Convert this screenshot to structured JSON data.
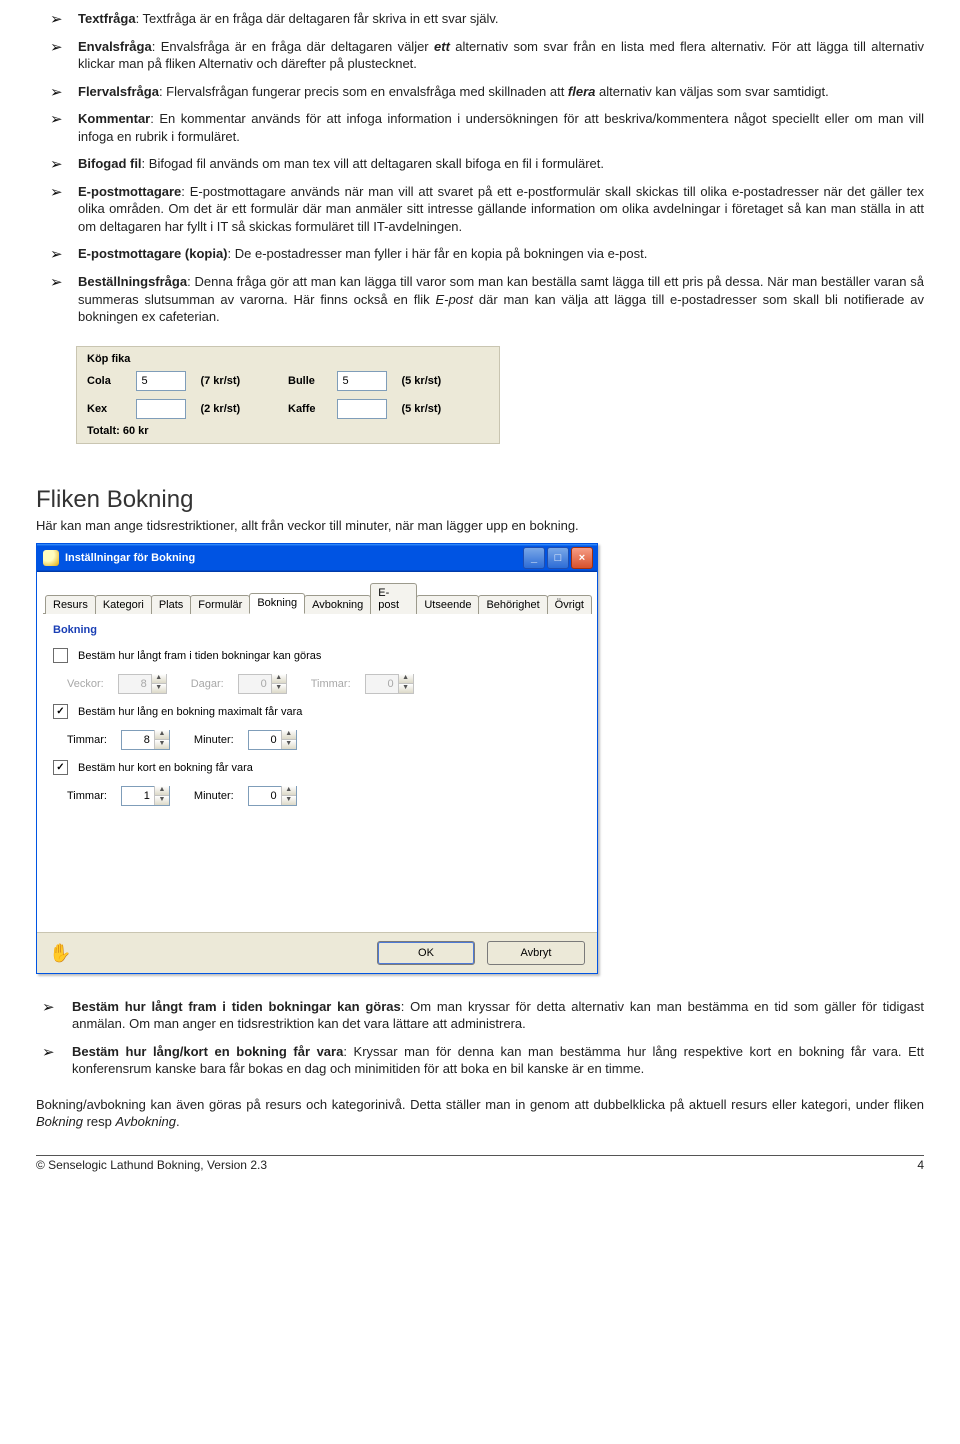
{
  "bul": [
    {
      "title": "Textfråga",
      "body": ": Textfråga är en fråga där deltagaren får skriva in ett svar själv."
    },
    {
      "title": "Envalsfråga",
      "body": ": Envalsfråga är en fråga där deltagaren väljer ",
      "e1": "ett",
      "tail": " alternativ som svar från en lista med flera alternativ. För att lägga till alternativ klickar man på fliken Alternativ och därefter på plustecknet."
    },
    {
      "title": "Flervalsfråga",
      "body": ": Flervalsfrågan fungerar precis som en envalsfråga med skillnaden att ",
      "e1": "flera",
      "tail": " alternativ kan väljas som svar samtidigt."
    },
    {
      "title": "Kommentar",
      "body": ": En kommentar används för att infoga information i undersökningen för att beskriva/kommentera något speciellt eller om man vill infoga en rubrik i formuläret."
    },
    {
      "title": "Bifogad fil",
      "body": ": Bifogad fil används om man tex vill att deltagaren skall bifoga en fil i formuläret."
    },
    {
      "title": "E-postmottagare",
      "body": ": E-postmottagare används när man vill att svaret på ett e-postformulär skall skickas till olika e-postadresser när det gäller tex olika områden. Om det är ett formulär där man anmäler sitt intresse gällande information om olika avdelningar i företaget så kan man ställa in att om deltagaren har fyllt i IT så skickas formuläret till IT-avdelningen."
    },
    {
      "title": "E-postmottagare (kopia)",
      "body": ": De e-postadresser man fyller i här får en kopia på bokningen via e-post."
    },
    {
      "title": "Beställningsfråga",
      "body": ": Denna fråga gör att man kan lägga till varor som man kan beställa samt lägga till ett pris på dessa. När man beställer varan så summeras slutsumman av varorna. Här finns också en flik ",
      "e1": "E-post",
      "tail": " där man kan välja att lägga till e-postadresser som skall bli notifierade av bokningen ex cafeterian."
    }
  ],
  "fika": {
    "title": "Köp fika",
    "rows": [
      {
        "l": "Cola",
        "v": "5",
        "p": "(7 kr/st)",
        "l2": "Bulle",
        "v2": "5",
        "p2": "(5 kr/st)"
      },
      {
        "l": "Kex",
        "v": "",
        "p": "(2 kr/st)",
        "l2": "Kaffe",
        "v2": "",
        "p2": "(5 kr/st)"
      }
    ],
    "total": "Totalt: 60 kr"
  },
  "heading": "Fliken Bokning",
  "sub": "Här kan man ange tidsrestriktioner, allt från veckor till minuter, när man lägger upp en bokning.",
  "dialog": {
    "title": "Inställningar för Bokning",
    "tabs": [
      "Resurs",
      "Kategori",
      "Plats",
      "Formulär",
      "Bokning",
      "Avbokning",
      "E-post",
      "Utseende",
      "Behörighet",
      "Övrigt"
    ],
    "active": 4,
    "group": "Bokning",
    "r1": {
      "cb": false,
      "lbl": "Bestäm hur långt fram i tiden bokningar kan göras",
      "f": [
        {
          "l": "Veckor:",
          "v": "8"
        },
        {
          "l": "Dagar:",
          "v": "0"
        },
        {
          "l": "Timmar:",
          "v": "0"
        }
      ]
    },
    "r2": {
      "cb": true,
      "lbl": "Bestäm hur lång en bokning maximalt får vara",
      "f": [
        {
          "l": "Timmar:",
          "v": "8"
        },
        {
          "l": "Minuter:",
          "v": "0"
        }
      ]
    },
    "r3": {
      "cb": true,
      "lbl": "Bestäm hur kort en bokning får vara",
      "f": [
        {
          "l": "Timmar:",
          "v": "1"
        },
        {
          "l": "Minuter:",
          "v": "0"
        }
      ]
    },
    "ok": "OK",
    "cancel": "Avbryt"
  },
  "bul2": [
    {
      "title": "Bestäm hur långt fram i tiden bokningar kan göras",
      "body": ": Om man kryssar för detta alternativ kan man bestämma en tid som gäller för tidigast anmälan. Om man anger en tidsrestriktion kan det vara lättare att administrera."
    },
    {
      "title": "Bestäm hur lång/kort en bokning får vara",
      "body": ": Kryssar man för denna kan man bestämma hur lång respektive kort en bokning får vara. Ett konferensrum kanske bara får bokas en dag och minimitiden för att boka en bil kanske är en timme."
    }
  ],
  "para": {
    "a": "Bokning/avbokning kan även göras på resurs och kategorinivå. Detta ställer man in genom att dubbelklicka på aktuell resurs eller kategori, under fliken ",
    "b": "Bokning",
    "c": " resp ",
    "d": "Avbokning",
    "e": "."
  },
  "footer": {
    "l": "© Senselogic Lathund Bokning, Version 2.3",
    "r": "4"
  }
}
